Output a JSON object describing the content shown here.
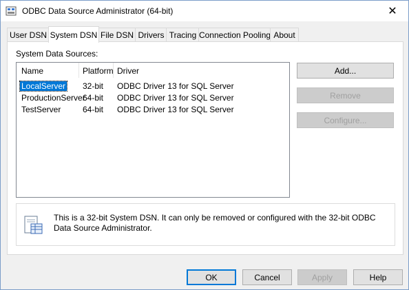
{
  "window": {
    "title": "ODBC Data Source Administrator (64-bit)",
    "close_glyph": "✕"
  },
  "tabs": [
    {
      "label": "User DSN"
    },
    {
      "label": "System DSN",
      "active": true
    },
    {
      "label": "File DSN"
    },
    {
      "label": "Drivers"
    },
    {
      "label": "Tracing"
    },
    {
      "label": "Connection Pooling"
    },
    {
      "label": "About"
    }
  ],
  "group_label": "System Data Sources:",
  "columns": {
    "name": "Name",
    "platform": "Platform",
    "driver": "Driver"
  },
  "rows": [
    {
      "name": "LocalServer",
      "platform": "32-bit",
      "driver": "ODBC Driver 13 for SQL Server",
      "selected": true
    },
    {
      "name": "ProductionServer",
      "platform": "64-bit",
      "driver": "ODBC Driver 13 for SQL Server"
    },
    {
      "name": "TestServer",
      "platform": "64-bit",
      "driver": "ODBC Driver 13 for SQL Server"
    }
  ],
  "side_buttons": {
    "add": "Add...",
    "remove": "Remove",
    "configure": "Configure..."
  },
  "info_text": "This is a 32-bit System DSN. It can only be removed or configured with the 32-bit ODBC Data Source Administrator.",
  "footer_buttons": {
    "ok": "OK",
    "cancel": "Cancel",
    "apply": "Apply",
    "help": "Help"
  },
  "colors": {
    "selection": "#0078d7",
    "default_button_border": "#0078d7"
  }
}
